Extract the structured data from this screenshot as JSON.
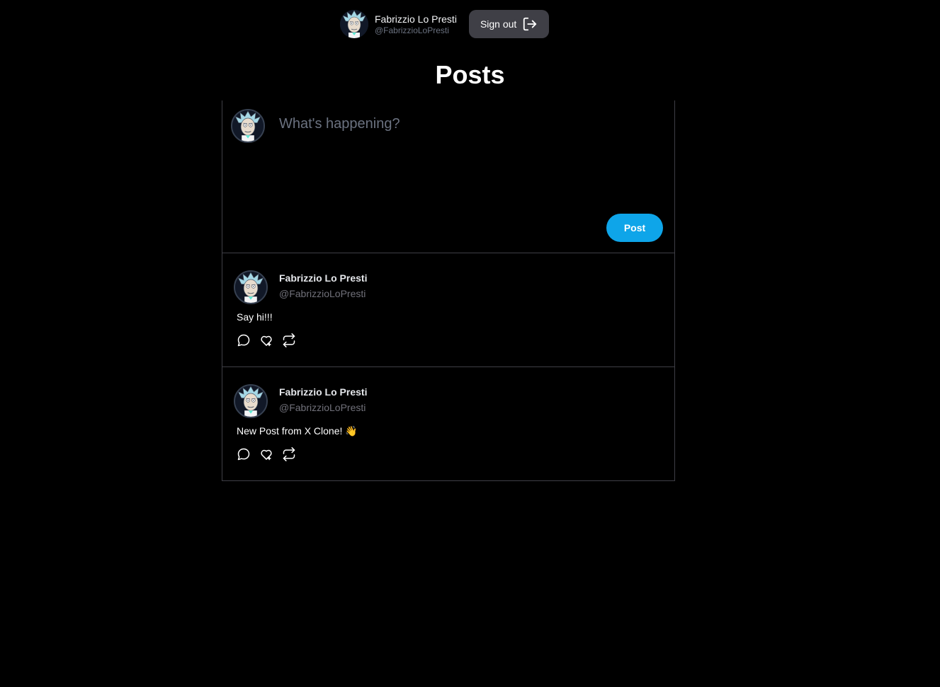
{
  "header": {
    "user_name": "Fabrizzio Lo Presti",
    "user_handle": "@FabrizzioLoPresti",
    "signout_label": "Sign out"
  },
  "page": {
    "title": "Posts"
  },
  "composer": {
    "placeholder": "What's happening?",
    "post_label": "Post"
  },
  "posts": [
    {
      "author": "Fabrizzio Lo Presti",
      "handle": "@FabrizzioLoPresti",
      "content": "Say hi!!!"
    },
    {
      "author": "Fabrizzio Lo Presti",
      "handle": "@FabrizzioLoPresti",
      "content": "New Post from X Clone! 👋"
    }
  ],
  "icons": {
    "signout": "sign-out-icon",
    "reply": "chat-bubble-icon",
    "like": "heart-icon",
    "repost": "repost-icon",
    "avatar": "rick-avatar"
  },
  "colors": {
    "background": "#000000",
    "accent": "#0ea5e9",
    "border": "#3f3f46",
    "signout_bg": "#3f3f46"
  }
}
